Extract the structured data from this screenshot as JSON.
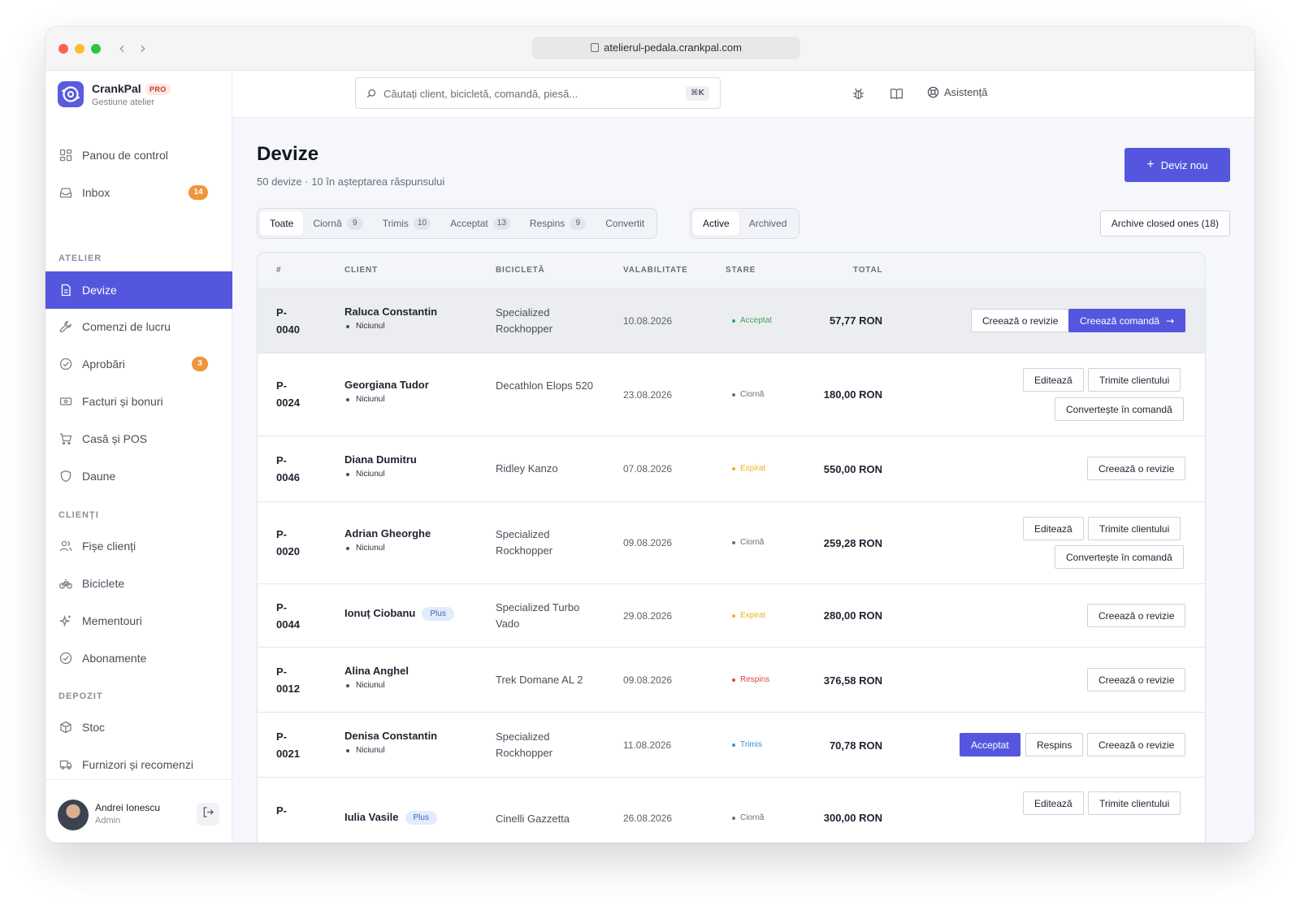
{
  "browser": {
    "url": "atelierul-pedala.crankpal.com"
  },
  "brand": {
    "name": "CrankPal",
    "badge": "PRO",
    "subtitle": "Gestiune atelier"
  },
  "search": {
    "placeholder": "Căutați client, bicicletă, comandă, piesă...",
    "shortcut": "⌘K"
  },
  "topbar": {
    "help_label": "Asistență"
  },
  "sidebar": {
    "top_items": [
      {
        "label": "Panou de control",
        "icon": "dashboard-icon"
      },
      {
        "label": "Inbox",
        "icon": "inbox-icon",
        "badge": "14"
      }
    ],
    "section_atelier": "ATELIER",
    "atelier_items": [
      {
        "label": "Devize",
        "icon": "document-icon",
        "active": true
      },
      {
        "label": "Comenzi de lucru",
        "icon": "wrench-icon"
      },
      {
        "label": "Aprobări",
        "icon": "check-circle-icon",
        "badge": "3"
      },
      {
        "label": "Facturi și bonuri",
        "icon": "receipt-icon"
      },
      {
        "label": "Casă și POS",
        "icon": "cart-icon"
      },
      {
        "label": "Daune",
        "icon": "shield-icon"
      }
    ],
    "section_clienti": "CLIENȚI",
    "clienti_items": [
      {
        "label": "Fișe clienți",
        "icon": "users-icon"
      },
      {
        "label": "Biciclete",
        "icon": "bicycle-icon"
      },
      {
        "label": "Mementouri",
        "icon": "sparkle-icon"
      },
      {
        "label": "Abonamente",
        "icon": "check-circle-icon"
      }
    ],
    "section_depozit": "DEPOZIT",
    "depozit_items": [
      {
        "label": "Stoc",
        "icon": "box-icon"
      },
      {
        "label": "Furnizori și recomenzi",
        "icon": "truck-icon"
      }
    ],
    "user": {
      "name": "Andrei Ionescu",
      "role": "Admin"
    }
  },
  "page": {
    "title": "Devize",
    "subtitle": "50 devize · 10 în așteptarea răspunsului",
    "new_button": "Deviz nou",
    "archive_button": "Archive closed ones (18)"
  },
  "filter_tabs": [
    {
      "label": "Toate",
      "active": true
    },
    {
      "label": "Ciornă",
      "count": "9"
    },
    {
      "label": "Trimis",
      "count": "10"
    },
    {
      "label": "Acceptat",
      "count": "13"
    },
    {
      "label": "Respins",
      "count": "9"
    },
    {
      "label": "Convertit"
    }
  ],
  "scope_tabs": [
    {
      "label": "Active",
      "active": true
    },
    {
      "label": "Archived"
    }
  ],
  "table": {
    "headers": {
      "id": "#",
      "client": "CLIENT",
      "bike": "BICICLETĂ",
      "validity": "VALABILITATE",
      "status": "STARE",
      "total": "TOTAL"
    },
    "rows": [
      {
        "id": "P-0040",
        "client": "Raluca Constantin",
        "tag": "Niciunul",
        "bike": "Specialized Rockhopper",
        "validity": "10.08.2026",
        "status": "Acceptat",
        "status_color": "#3aa55d",
        "total": "57,77 RON",
        "actions": [
          "Creează o revizie",
          "Creează comandă"
        ]
      },
      {
        "id": "P-0024",
        "client": "Georgiana Tudor",
        "tag": "Niciunul",
        "bike": "Decathlon Elops 520",
        "validity": "23.08.2026",
        "status": "Ciornă",
        "status_color": "#6b6e76",
        "total": "180,00 RON",
        "actions": [
          "Editează",
          "Trimite clientului",
          "Convertește în comandă"
        ]
      },
      {
        "id": "P-0046",
        "client": "Diana Dumitru",
        "tag": "Niciunul",
        "bike": "Ridley Kanzo",
        "validity": "07.08.2026",
        "status": "Expirat",
        "status_color": "#e9b21c",
        "total": "550,00 RON",
        "actions": [
          "Creează o revizie"
        ]
      },
      {
        "id": "P-0020",
        "client": "Adrian Gheorghe",
        "tag": "Niciunul",
        "bike": "Specialized Rockhopper",
        "validity": "09.08.2026",
        "status": "Ciornă",
        "status_color": "#6b6e76",
        "total": "259,28 RON",
        "actions": [
          "Editează",
          "Trimite clientului",
          "Convertește în comandă"
        ]
      },
      {
        "id": "P-0044",
        "client": "Ionuț Ciobanu",
        "badge": "Plus",
        "bike": "Specialized Turbo Vado",
        "validity": "29.08.2026",
        "status": "Expirat",
        "status_color": "#e9b21c",
        "total": "280,00 RON",
        "actions": [
          "Creează o revizie"
        ]
      },
      {
        "id": "P-0012",
        "client": "Alina Anghel",
        "tag": "Niciunul",
        "bike": "Trek Domane AL 2",
        "validity": "09.08.2026",
        "status": "Respins",
        "status_color": "#e0463f",
        "total": "376,58 RON",
        "actions": [
          "Creează o revizie"
        ]
      },
      {
        "id": "P-0021",
        "client": "Denisa Constantin",
        "tag": "Niciunul",
        "bike": "Specialized Rockhopper",
        "validity": "11.08.2026",
        "status": "Trimis",
        "status_color": "#3b8fd6",
        "total": "70,78 RON",
        "actions": [
          "Acceptat",
          "Respins",
          "Creează o revizie"
        ]
      },
      {
        "id": "P-",
        "client": "Iulia Vasile",
        "badge": "Plus",
        "bike": "Cinelli Gazzetta",
        "validity": "26.08.2026",
        "status": "Ciornă",
        "status_color": "#6b6e76",
        "total": "300,00 RON",
        "actions": [
          "Editează",
          "Trimite clientului"
        ]
      }
    ]
  },
  "colors": {
    "accent": "#5457dd",
    "badge": "#f0953a"
  }
}
